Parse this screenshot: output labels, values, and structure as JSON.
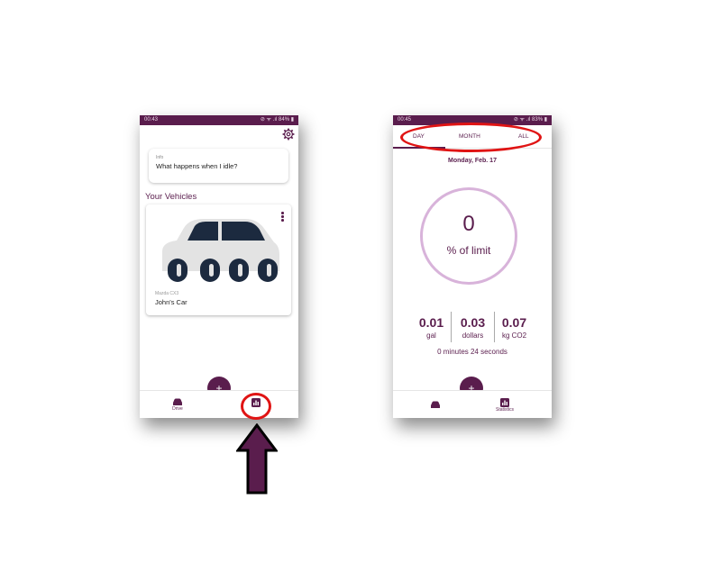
{
  "left_screen": {
    "status": {
      "time": "00:43",
      "icons": "⊘ ᯤ .ıl 84% ▮"
    },
    "settings_icon": "gear-icon",
    "info_card": {
      "label": "Info",
      "text": "What happens when I idle?"
    },
    "vehicles_title": "Your Vehicles",
    "vehicle": {
      "model": "Mazda CX3",
      "name": "John's Car"
    },
    "fab_label": "+",
    "nav": {
      "drive_label": "Drive"
    }
  },
  "right_screen": {
    "status": {
      "time": "00:45",
      "icons": "⊘ ᯤ .ıl 83% ▮"
    },
    "tabs": [
      "DAY",
      "MONTH",
      "ALL"
    ],
    "date": "Monday, Feb. 17",
    "gauge": {
      "value": "0",
      "label": "% of limit"
    },
    "stats": [
      {
        "value": "0.01",
        "unit": "gal"
      },
      {
        "value": "0.03",
        "unit": "dollars"
      },
      {
        "value": "0.07",
        "unit": "kg CO2"
      }
    ],
    "duration": "0 minutes 24 seconds",
    "fab_label": "+",
    "nav": {
      "statistics_label": "Statistics"
    }
  },
  "colors": {
    "brand": "#5a1d4d",
    "highlight": "#e01414",
    "gauge_ring": "#d8b3da",
    "car_body": "#e3e3e3",
    "car_dark": "#1c2a3f"
  }
}
